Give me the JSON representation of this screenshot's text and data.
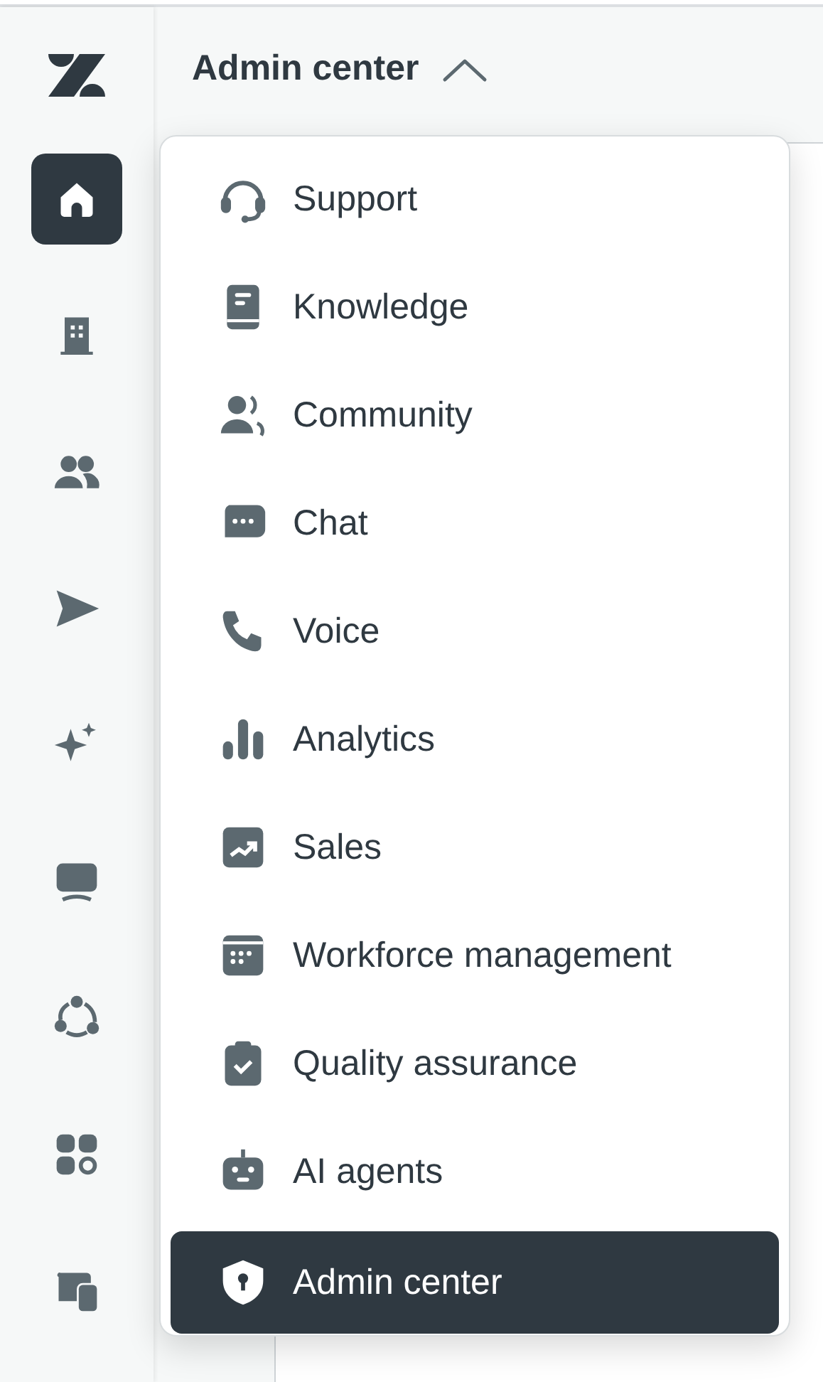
{
  "header": {
    "title": "Admin center",
    "menu_expanded": true
  },
  "sidebar": {
    "items": [
      {
        "selected": true
      },
      {
        "selected": false
      },
      {
        "selected": false
      },
      {
        "selected": false
      },
      {
        "selected": false
      },
      {
        "selected": false
      },
      {
        "selected": false
      },
      {
        "selected": false
      },
      {
        "selected": false
      }
    ]
  },
  "product_menu": {
    "items": [
      {
        "label": "Support",
        "selected": false
      },
      {
        "label": "Knowledge",
        "selected": false
      },
      {
        "label": "Community",
        "selected": false
      },
      {
        "label": "Chat",
        "selected": false
      },
      {
        "label": "Voice",
        "selected": false
      },
      {
        "label": "Analytics",
        "selected": false
      },
      {
        "label": "Sales",
        "selected": false
      },
      {
        "label": "Workforce management",
        "selected": false
      },
      {
        "label": "Quality assurance",
        "selected": false
      },
      {
        "label": "AI agents",
        "selected": false
      },
      {
        "label": "Admin center",
        "selected": true
      }
    ]
  }
}
